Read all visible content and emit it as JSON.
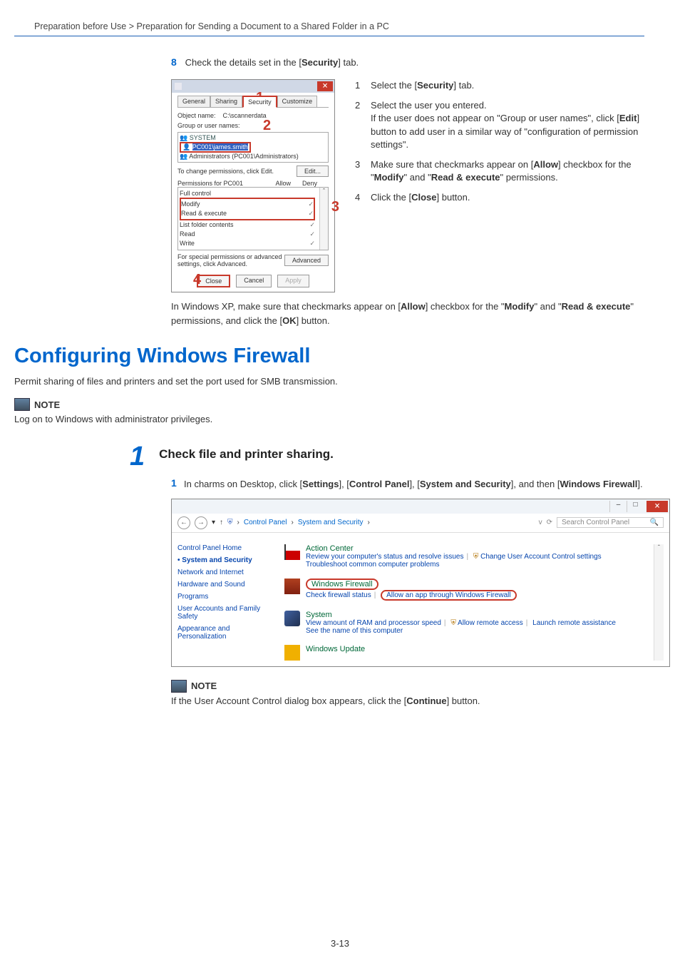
{
  "breadcrumb": "Preparation before Use > Preparation for Sending a Document to a Shared Folder in a PC",
  "step8": {
    "num": "8",
    "text_a": "Check the details set in the [",
    "bold": "Security",
    "text_b": "] tab."
  },
  "dialog": {
    "tabs": {
      "general": "General",
      "sharing": "Sharing",
      "security": "Security",
      "customize": "Customize"
    },
    "object_label": "Object name:",
    "object_value": "C:\\scannerdata",
    "group_label": "Group or user names:",
    "group_system": "SYSTEM",
    "group_selected": "PC001\\james.smith",
    "group_admins": "Administrators (PC001\\Administrators)",
    "change_perm": "To change permissions, click Edit.",
    "edit_btn": "Edit...",
    "perm_for": "Permissions for PC001",
    "allow": "Allow",
    "deny": "Deny",
    "perm_full": "Full control",
    "perm_modify": "Modify",
    "perm_exec": "Read & execute",
    "perm_list": "List folder contents",
    "perm_read": "Read",
    "perm_write": "Write",
    "special": "For special permissions or advanced settings, click Advanced.",
    "advanced_btn": "Advanced",
    "close_btn": "Close",
    "cancel_btn": "Cancel",
    "apply_btn": "Apply",
    "callouts": {
      "c1": "1",
      "c2": "2",
      "c3": "3",
      "c4": "4"
    }
  },
  "right_steps": {
    "s1": {
      "n": "1",
      "a": "Select the [",
      "b": "Security",
      "c": "] tab."
    },
    "s2": {
      "n": "2",
      "a": "Select the user you entered.",
      "b": "If the user does not appear on \"Group or user names\", click [",
      "c": "Edit",
      "d": "] button to add user in a similar way of \"configuration of permission settings\"."
    },
    "s3": {
      "n": "3",
      "a": "Make sure that checkmarks appear on [",
      "b": "Allow",
      "c": "] checkbox for the \"",
      "d": "Modify",
      "e": "\" and \"",
      "f": "Read & execute",
      "g": "\" permissions."
    },
    "s4": {
      "n": "4",
      "a": "Click the [",
      "b": "Close",
      "c": "] button."
    }
  },
  "xp_note": {
    "a": "In Windows XP, make sure that checkmarks appear on [",
    "b": "Allow",
    "c": "] checkbox for the \"",
    "d": "Modify",
    "e": "\" and \"",
    "f": "Read & execute",
    "g": "\" permissions, and click the [",
    "h": "OK",
    "i": "] button."
  },
  "h1": "Configuring Windows Firewall",
  "intro": "Permit sharing of files and printers and set the port used for SMB transmission.",
  "note_label": "NOTE",
  "note1": "Log on to Windows with administrator privileges.",
  "big_step": {
    "num": "1",
    "title": "Check file and printer sharing."
  },
  "sub1": {
    "n": "1",
    "a": "In charms on Desktop, click [",
    "b": "Settings",
    "c": "], [",
    "d": "Control Panel",
    "e": "], [",
    "f": "System and Security",
    "g": "], and then [",
    "h": "Windows Firewall",
    "i": "]."
  },
  "cp": {
    "bc1": "Control Panel",
    "bc2": "System and Security",
    "search_ph": "Search Control Panel",
    "side": {
      "home": "Control Panel Home",
      "sys": "System and Security",
      "net": "Network and Internet",
      "hw": "Hardware and Sound",
      "prog": "Programs",
      "uaf": "User Accounts and Family Safety",
      "app": "Appearance and Personalization"
    },
    "ac": {
      "title": "Action Center",
      "l1": "Review your computer's status and resolve issues",
      "l2": "Change User Account Control settings",
      "l3": "Troubleshoot common computer problems"
    },
    "wf": {
      "title": "Windows Firewall",
      "l1": "Check firewall status",
      "l2": "Allow an app through Windows Firewall"
    },
    "sys": {
      "title": "System",
      "l1": "View amount of RAM and processor speed",
      "l2": "Allow remote access",
      "l3": "Launch remote assistance",
      "l4": "See the name of this computer"
    },
    "wu": {
      "title": "Windows Update"
    }
  },
  "note2": {
    "a": "If the User Account Control dialog box appears, click the [",
    "b": "Continue",
    "c": "] button."
  },
  "page_num": "3-13"
}
